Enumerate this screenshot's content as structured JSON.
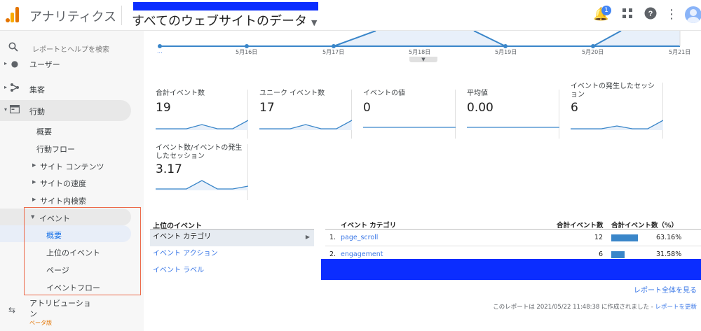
{
  "header": {
    "app_name": "アナリティクス",
    "property": "すべてのウェブサイトのデータ",
    "notification_count": "1"
  },
  "sidebar": {
    "search_placeholder": "レポートとヘルプを検索",
    "items": [
      {
        "label": "ユーザー"
      },
      {
        "label": "集客"
      },
      {
        "label": "行動"
      }
    ],
    "behavior_sub": [
      {
        "label": "概要"
      },
      {
        "label": "行動フロー"
      },
      {
        "label": "サイト コンテンツ"
      },
      {
        "label": "サイトの速度"
      },
      {
        "label": "サイト内検索"
      }
    ],
    "events": {
      "label": "イベント",
      "sub": [
        {
          "label": "概要"
        },
        {
          "label": "上位のイベント"
        },
        {
          "label": "ページ"
        },
        {
          "label": "イベントフロー"
        }
      ]
    },
    "attribution": {
      "label1": "アトリビューショ",
      "label2": "ン",
      "beta": "ベータ版"
    }
  },
  "timeline": {
    "dates": [
      "...",
      "5月16日",
      "5月17日",
      "5月18日",
      "5月19日",
      "5月20日",
      "5月21日"
    ]
  },
  "metrics": [
    {
      "label": "合計イベント数",
      "value": "19"
    },
    {
      "label": "ユニーク イベント数",
      "value": "17"
    },
    {
      "label": "イベントの値",
      "value": "0"
    },
    {
      "label": "平均値",
      "value": "0.00"
    },
    {
      "label": "イベントの発生したセッション",
      "value": "6"
    },
    {
      "label": "イベント数/イベントの発生したセッション",
      "value": "3.17"
    }
  ],
  "top_events": {
    "title": "上位のイベント",
    "options": [
      "イベント カテゴリ",
      "イベント アクション",
      "イベント ラベル"
    ]
  },
  "table": {
    "columns": [
      "イベント カテゴリ",
      "合計イベント数",
      "合計イベント数（%）"
    ],
    "rows": [
      {
        "index": "1.",
        "category": "page_scroll",
        "count": "12",
        "pct": "63.16%",
        "share": 0.6316
      },
      {
        "index": "2.",
        "category": "engagement",
        "count": "6",
        "pct": "31.58%",
        "share": 0.3158
      }
    ],
    "full_report": "レポート全体を見る",
    "footer_text": "このレポートは 2021/05/22 11:48:38 に作成されました - ",
    "footer_link": "レポートを更新"
  }
}
